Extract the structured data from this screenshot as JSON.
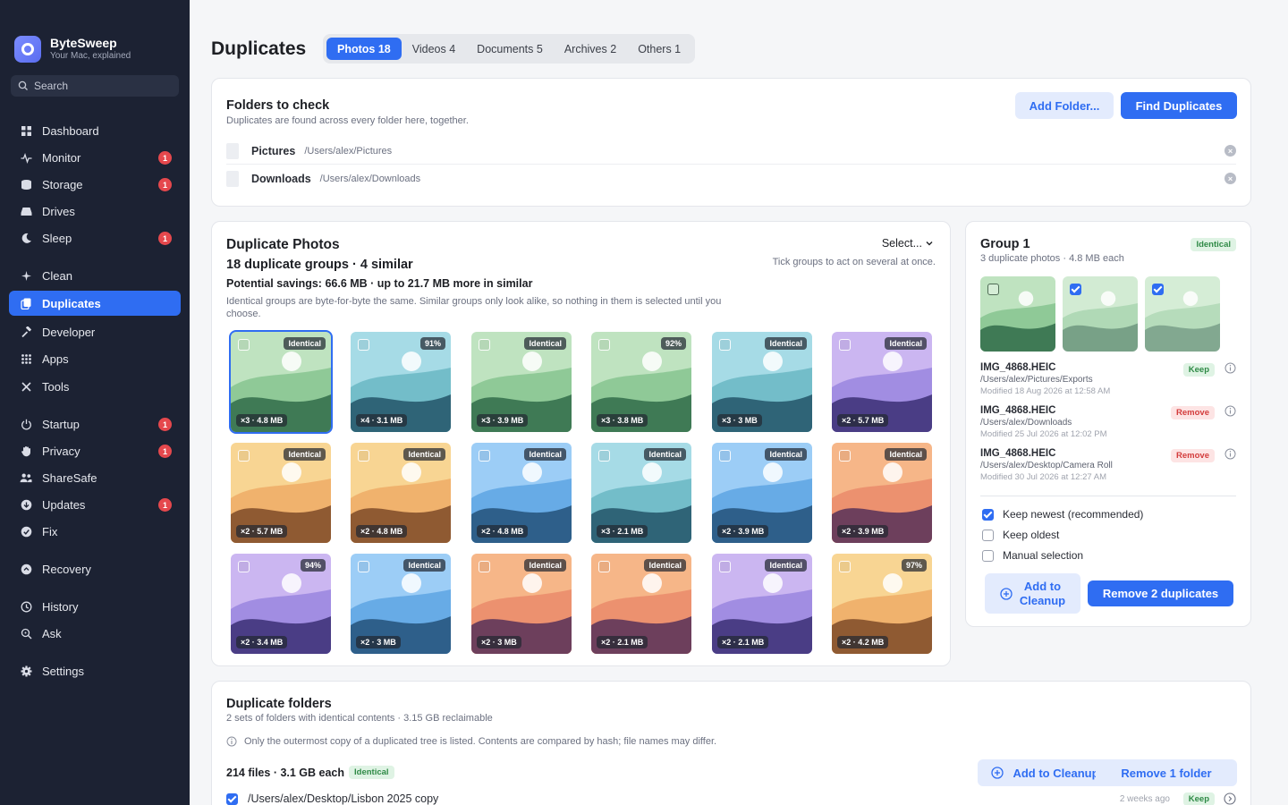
{
  "app": {
    "name": "ByteSweep",
    "tagline": "Your Mac, explained"
  },
  "search": {
    "label": "Search"
  },
  "sidebar": {
    "items": [
      {
        "label": "Dashboard",
        "icon": "grid-icon",
        "badge": ""
      },
      {
        "label": "Monitor",
        "icon": "pulse-icon",
        "badge": "1"
      },
      {
        "label": "Storage",
        "icon": "storage-icon",
        "badge": "1"
      },
      {
        "label": "Drives",
        "icon": "drive-icon",
        "badge": ""
      },
      {
        "label": "Sleep",
        "icon": "moon-icon",
        "badge": "1"
      },
      {
        "label": "Clean",
        "icon": "sparkle-icon",
        "badge": ""
      },
      {
        "label": "Duplicates",
        "icon": "duplicate-icon",
        "badge": ""
      },
      {
        "label": "Developer",
        "icon": "hammer-icon",
        "badge": ""
      },
      {
        "label": "Apps",
        "icon": "apps-icon",
        "badge": ""
      },
      {
        "label": "Tools",
        "icon": "tools-icon",
        "badge": ""
      },
      {
        "label": "Startup",
        "icon": "power-icon",
        "badge": "1"
      },
      {
        "label": "Privacy",
        "icon": "hand-icon",
        "badge": "1"
      },
      {
        "label": "ShareSafe",
        "icon": "people-icon",
        "badge": ""
      },
      {
        "label": "Updates",
        "icon": "download-icon",
        "badge": "1"
      },
      {
        "label": "Fix",
        "icon": "wrench-icon",
        "badge": ""
      },
      {
        "label": "Recovery",
        "icon": "recovery-icon",
        "badge": ""
      },
      {
        "label": "History",
        "icon": "history-icon",
        "badge": ""
      },
      {
        "label": "Ask",
        "icon": "ask-icon",
        "badge": ""
      },
      {
        "label": "Settings",
        "icon": "gear-icon",
        "badge": ""
      }
    ],
    "active": "Duplicates"
  },
  "header": {
    "title": "Duplicates",
    "tabs": [
      {
        "label": "Photos 18"
      },
      {
        "label": "Videos 4"
      },
      {
        "label": "Documents 5"
      },
      {
        "label": "Archives 2"
      },
      {
        "label": "Others 1"
      }
    ]
  },
  "folders": {
    "title": "Folders to check",
    "subtitle": "Duplicates are found across every folder here, together.",
    "add_label": "Add Folder...",
    "find_label": "Find Duplicates",
    "items": [
      {
        "name": "Pictures",
        "path": "/Users/alex/Pictures"
      },
      {
        "name": "Downloads",
        "path": "/Users/alex/Downloads"
      }
    ]
  },
  "photos": {
    "title": "Duplicate Photos",
    "summary": "18 duplicate groups · 4 similar",
    "savings": "Potential savings: 66.6 MB · up to 21.7 MB more in similar",
    "note": "Identical groups are byte-for-byte the same. Similar groups only look alike, so nothing in them is selected until you choose.",
    "select_label": "Select...",
    "select_hint": "Tick groups to act on several at once.",
    "grid": [
      {
        "tag": "Identical",
        "meta": "×3 · 4.8 MB",
        "palette": "green",
        "selected": true
      },
      {
        "tag": "91%",
        "meta": "×4 · 3.1 MB",
        "palette": "teal"
      },
      {
        "tag": "Identical",
        "meta": "×3 · 3.9 MB",
        "palette": "green"
      },
      {
        "tag": "92%",
        "meta": "×3 · 3.8 MB",
        "palette": "green"
      },
      {
        "tag": "Identical",
        "meta": "×3 · 3 MB",
        "palette": "teal"
      },
      {
        "tag": "Identical",
        "meta": "×2 · 5.7 MB",
        "palette": "purple"
      },
      {
        "tag": "Identical",
        "meta": "×2 · 5.7 MB",
        "palette": "orange"
      },
      {
        "tag": "Identical",
        "meta": "×2 · 4.8 MB",
        "palette": "orange"
      },
      {
        "tag": "Identical",
        "meta": "×2 · 4.8 MB",
        "palette": "blue"
      },
      {
        "tag": "Identical",
        "meta": "×3 · 2.1 MB",
        "palette": "teal"
      },
      {
        "tag": "Identical",
        "meta": "×2 · 3.9 MB",
        "palette": "blue"
      },
      {
        "tag": "Identical",
        "meta": "×2 · 3.9 MB",
        "palette": "sunset"
      },
      {
        "tag": "94%",
        "meta": "×2 · 3.4 MB",
        "palette": "purple"
      },
      {
        "tag": "Identical",
        "meta": "×2 · 3 MB",
        "palette": "blue"
      },
      {
        "tag": "Identical",
        "meta": "×2 · 3 MB",
        "palette": "sunset"
      },
      {
        "tag": "Identical",
        "meta": "×2 · 2.1 MB",
        "palette": "sunset"
      },
      {
        "tag": "Identical",
        "meta": "×2 · 2.1 MB",
        "palette": "purple"
      },
      {
        "tag": "97%",
        "meta": "×2 · 4.2 MB",
        "palette": "orange"
      }
    ]
  },
  "group": {
    "title": "Group 1",
    "badge": "Identical",
    "subtitle": "3 duplicate photos · 4.8 MB each",
    "files": [
      {
        "name": "IMG_4868.HEIC",
        "path": "/Users/alex/Pictures/Exports",
        "modified": "Modified 18 Aug 2026 at 12:58 AM",
        "action": "Keep"
      },
      {
        "name": "IMG_4868.HEIC",
        "path": "/Users/alex/Downloads",
        "modified": "Modified 25 Jul 2026 at 12:02 PM",
        "action": "Remove"
      },
      {
        "name": "IMG_4868.HEIC",
        "path": "/Users/alex/Desktop/Camera Roll",
        "modified": "Modified 30 Jul 2026 at 12:27 AM",
        "action": "Remove"
      }
    ],
    "options": [
      {
        "label": "Keep newest (recommended)",
        "checked": true
      },
      {
        "label": "Keep oldest",
        "checked": false
      },
      {
        "label": "Manual selection",
        "checked": false
      }
    ],
    "add_line1": "Add to",
    "add_line2": "Cleanup",
    "remove_label": "Remove 2 duplicates"
  },
  "dupfolders": {
    "title": "Duplicate folders",
    "subtitle": "2 sets of folders with identical contents · 3.15 GB reclaimable",
    "info": "Only the outermost copy of a duplicated tree is listed. Contents are compared by hash; file names may differ.",
    "set_summary": "214 files · 3.1 GB each",
    "set_badge": "Identical",
    "add_label": "Add to Cleanup",
    "remove_label": "Remove 1 folder",
    "row_path": "/Users/alex/Desktop/Lisbon 2025 copy",
    "row_time": "2 weeks ago",
    "row_action": "Keep"
  },
  "colors": {
    "accent": "#2f6df2",
    "sidebar_bg": "#1c2233",
    "badge_red": "#e5484d",
    "identical_green": "#2f8a46"
  }
}
